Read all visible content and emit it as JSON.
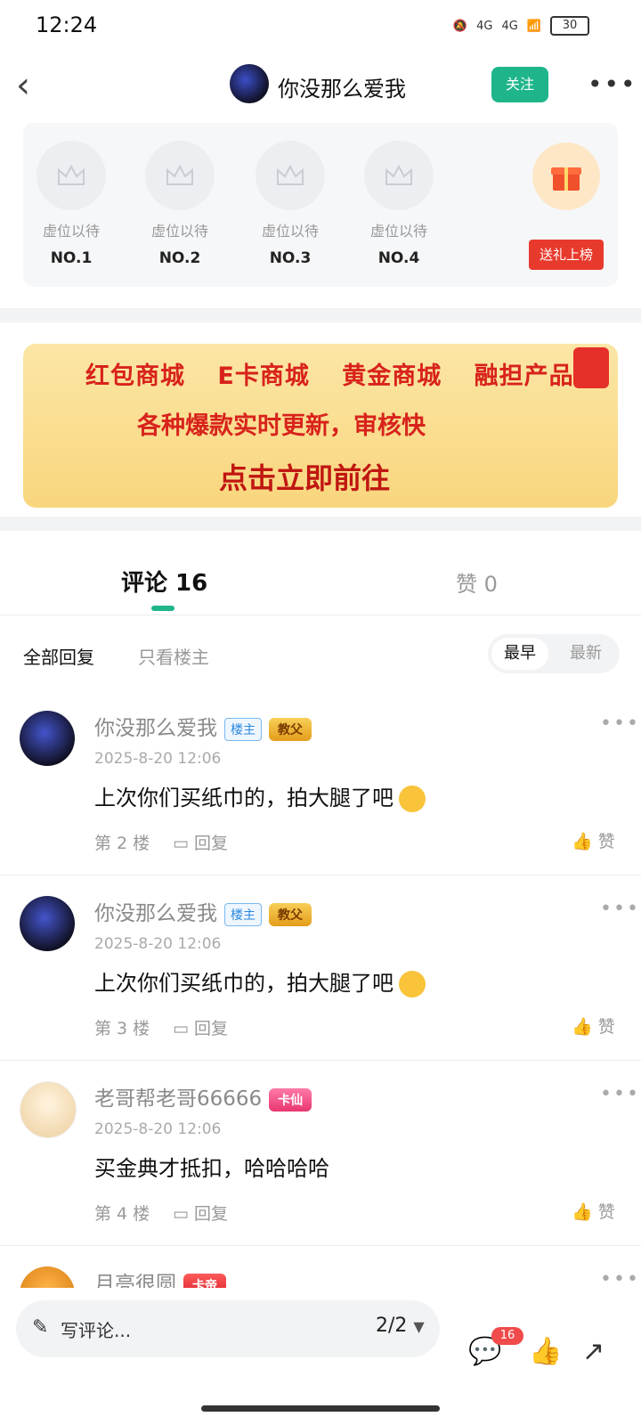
{
  "status_bar": {
    "time": "12:24",
    "network_1": "4G",
    "network_2": "4G",
    "battery": "30"
  },
  "header": {
    "title": "你没那么爱我",
    "follow_label": "关注"
  },
  "rank_card": {
    "seats": [
      {
        "label": "虚位以待",
        "rank": "NO.1"
      },
      {
        "label": "虚位以待",
        "rank": "NO.2"
      },
      {
        "label": "虚位以待",
        "rank": "NO.3"
      },
      {
        "label": "虚位以待",
        "rank": "NO.4"
      }
    ],
    "gift_button": "送礼上榜"
  },
  "banner": {
    "row1": "红包商城 E卡商城 黄金商城 融担产品",
    "row2": "各种爆款实时更新，审核快",
    "row3": "点击立即前往"
  },
  "tabs": {
    "comment": "评论 16",
    "like": "赞 0"
  },
  "filters": {
    "all": "全部回复",
    "host_only": "只看楼主",
    "sort_earliest": "最早",
    "sort_latest": "最新"
  },
  "comments": [
    {
      "name": "你没那么爱我",
      "host_badge": "楼主",
      "level": "教父",
      "time": "2025-8-20 12:06",
      "text": "上次你们买纸巾的，拍大腿了吧",
      "floor": "第 2 楼",
      "reply": "回复",
      "like": "赞"
    },
    {
      "name": "你没那么爱我",
      "host_badge": "楼主",
      "level": "教父",
      "time": "2025-8-20 12:06",
      "text": "上次你们买纸巾的，拍大腿了吧",
      "floor": "第 3 楼",
      "reply": "回复",
      "like": "赞"
    },
    {
      "name": "老哥帮老哥66666",
      "level": "卡仙",
      "time": "2025-8-20 12:06",
      "text": "买金典才抵扣，哈哈哈哈",
      "floor": "第 4 楼",
      "reply": "回复",
      "like": "赞"
    },
    {
      "name": "月亮很圆",
      "level": "卡帝"
    }
  ],
  "bottom_bar": {
    "write_placeholder": "写评论...",
    "page": "2/2",
    "comment_count": "16"
  }
}
